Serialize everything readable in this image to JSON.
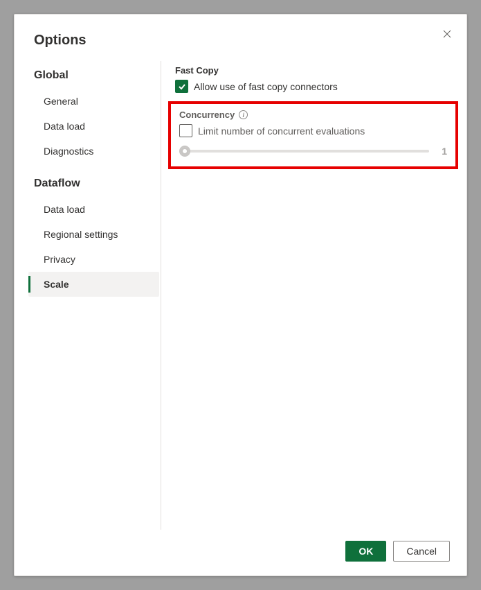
{
  "dialog": {
    "title": "Options"
  },
  "sidebar": {
    "groups": [
      {
        "label": "Global",
        "items": [
          {
            "label": "General"
          },
          {
            "label": "Data load"
          },
          {
            "label": "Diagnostics"
          }
        ]
      },
      {
        "label": "Dataflow",
        "items": [
          {
            "label": "Data load"
          },
          {
            "label": "Regional settings"
          },
          {
            "label": "Privacy"
          },
          {
            "label": "Scale",
            "selected": true
          }
        ]
      }
    ]
  },
  "content": {
    "fast_copy": {
      "header": "Fast Copy",
      "checkbox_label": "Allow use of fast copy connectors",
      "checked": true
    },
    "concurrency": {
      "header": "Concurrency",
      "checkbox_label": "Limit number of concurrent evaluations",
      "checked": false,
      "slider_value": "1"
    }
  },
  "footer": {
    "ok": "OK",
    "cancel": "Cancel"
  }
}
